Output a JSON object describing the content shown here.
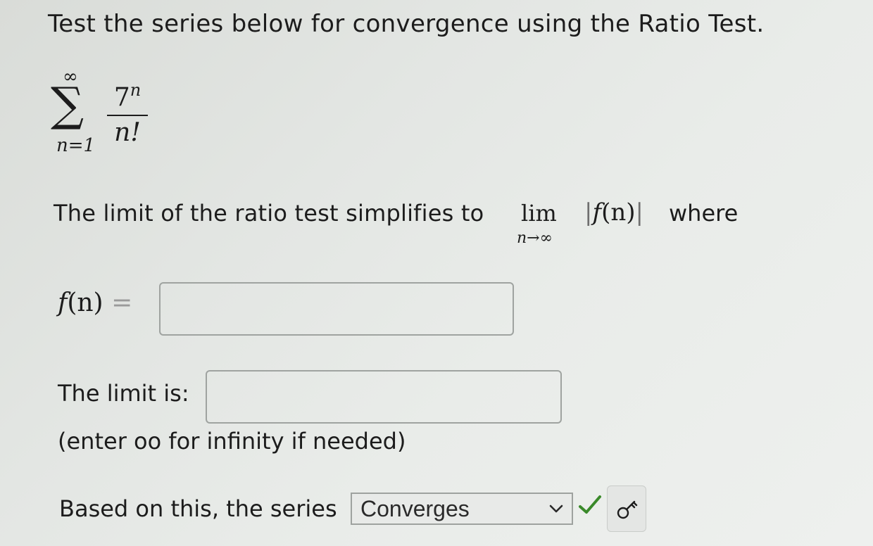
{
  "question": {
    "prompt": "Test the series below for convergence using the Ratio Test."
  },
  "series": {
    "upper": "∞",
    "lower": "n=1",
    "numerator_base": "7",
    "numerator_exp": "n",
    "denominator": "n!"
  },
  "limit_statement": {
    "text": "The limit of the ratio test simplifies to",
    "lim": "lim",
    "lim_sub": "n→∞",
    "f": "f",
    "n": "(n)",
    "where": "where"
  },
  "fn_row": {
    "f": "f",
    "n": "(n)",
    "eq": "=",
    "input_value": ""
  },
  "limit_row": {
    "label": "The limit is:",
    "input_value": ""
  },
  "hint": "(enter oo for infinity if needed)",
  "conclusion": {
    "label": "Based on this, the series",
    "selected": "Converges"
  },
  "colors": {
    "check": "#3a8a2a",
    "text": "#1c1c1c",
    "border": "#9fa3a0"
  },
  "icons": {
    "dropdown": "chevron-down-icon",
    "status": "check-icon",
    "key": "key-icon"
  }
}
